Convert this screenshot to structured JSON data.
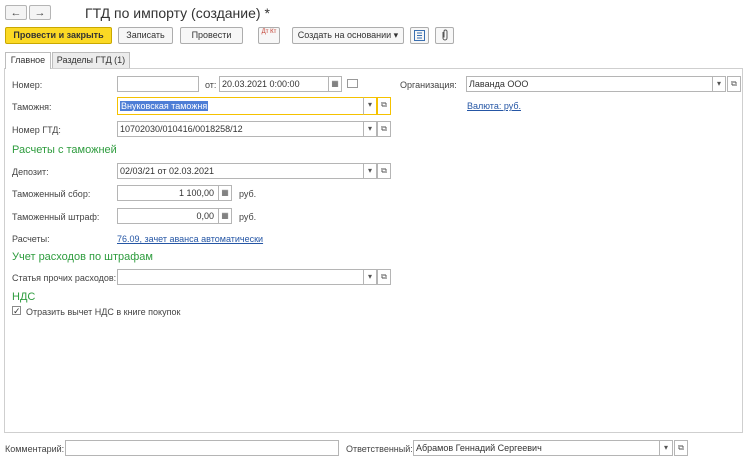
{
  "nav": {
    "back_glyph": "←",
    "forward_glyph": "→"
  },
  "header": {
    "title": "ГТД по импорту (создание) *"
  },
  "toolbar": {
    "post_close_label": "Провести и закрыть",
    "save_label": "Записать",
    "post_label": "Провести",
    "dtkt_label": "Дт Кт",
    "create_based_label": "Создать на основании",
    "create_based_arrow": "▾"
  },
  "tabs": [
    {
      "label": "Главное"
    },
    {
      "label": "Разделы ГТД (1)"
    }
  ],
  "form": {
    "number_label": "Номер:",
    "number_value": "",
    "date_label": "от:",
    "date_value": "20.03.2021  0:00:00",
    "org_label": "Организация:",
    "org_value": "Лаванда ООО",
    "customs_label": "Таможня:",
    "customs_value": "Внуковская таможня",
    "currency_link": "Валюта: руб.",
    "gtd_label": "Номер ГТД:",
    "gtd_value": "10702030/010416/0018258/12",
    "section_calc": "Расчеты с таможней",
    "deposit_label": "Депозит:",
    "deposit_value": "02/03/21 от 02.03.2021",
    "fee_label": "Таможенный сбор:",
    "fee_value": "1 100,00",
    "fee_unit": "руб.",
    "fine_label": "Таможенный штраф:",
    "fine_value": "0,00",
    "fine_unit": "руб.",
    "calc_label": "Расчеты:",
    "calc_link": "76.09, зачет аванса автоматически",
    "section_fines": "Учет расходов по штрафам",
    "expense_label": "Статья прочих расходов:",
    "expense_value": "",
    "section_vat": "НДС",
    "vat_check_label": "Отразить вычет НДС в книге покупок",
    "vat_checked": true
  },
  "footer": {
    "comment_label": "Комментарий:",
    "comment_value": "",
    "responsible_label": "Ответственный:",
    "responsible_value": "Абрамов Геннадий Сергеевич"
  },
  "icons": {
    "dropdown": "▾",
    "open": "⧉",
    "calendar": "▦",
    "calculator": "▦",
    "clip": "✎"
  },
  "colors": {
    "primary_button": "#fbd924",
    "section_heading": "#2e9c3e",
    "link": "#2556a5",
    "highlight": "#f5c200"
  }
}
